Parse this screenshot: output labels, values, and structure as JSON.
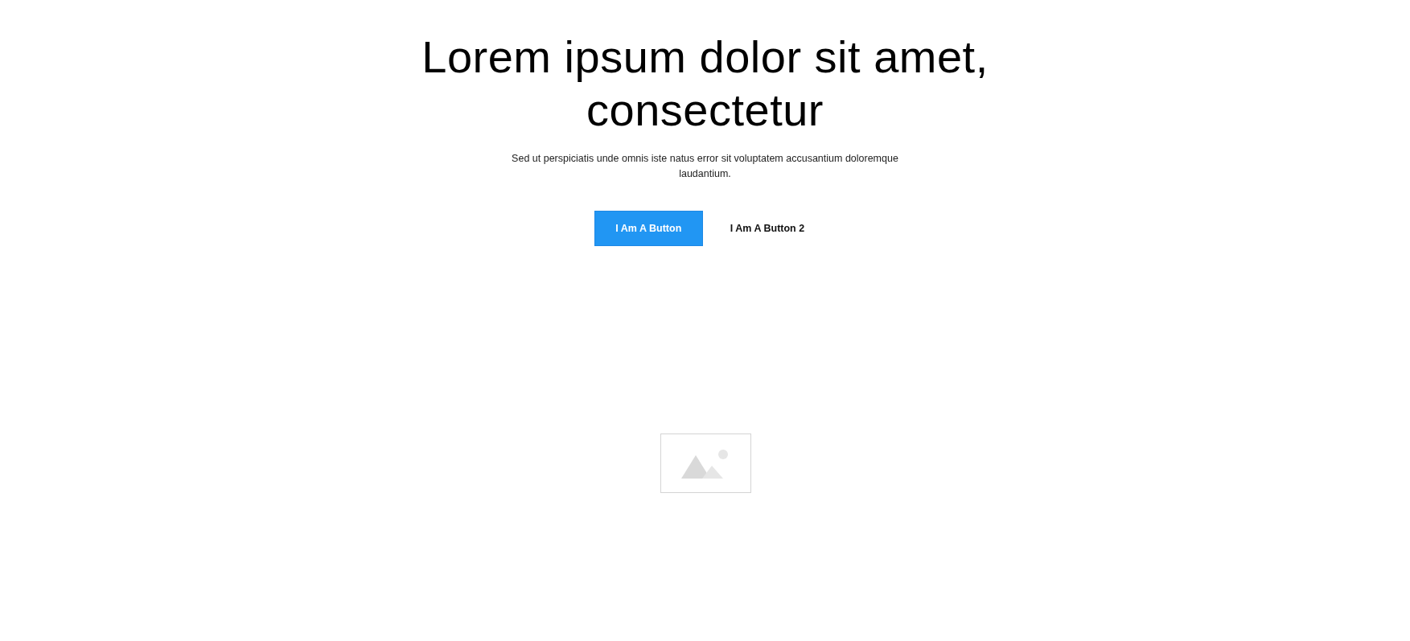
{
  "hero": {
    "heading": "Lorem ipsum dolor sit amet, consectetur",
    "subtitle": "Sed ut perspiciatis unde omnis iste natus error sit voluptatem accusantium doloremque laudantium.",
    "buttons": [
      {
        "label": "I Am A Button",
        "kind": "primary"
      },
      {
        "label": "I Am A Button 2",
        "kind": "text"
      }
    ]
  },
  "image": {
    "kind": "placeholder"
  }
}
